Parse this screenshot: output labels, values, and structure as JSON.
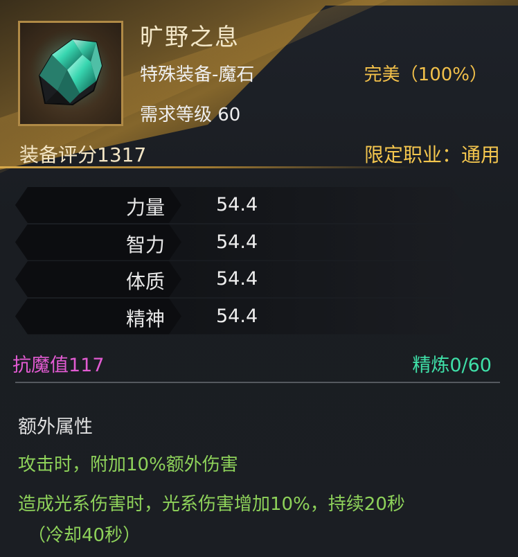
{
  "item": {
    "name": "旷野之息",
    "subtype": "特殊装备-魔石",
    "level_requirement": "需求等级 60",
    "quality": "完美（100%）",
    "score": "装备评分1317",
    "class_limit": "限定职业：通用",
    "icon": "green-crystal-magic-stone-icon"
  },
  "stats": [
    {
      "name": "力量",
      "value": "54.4"
    },
    {
      "name": "智力",
      "value": "54.4"
    },
    {
      "name": "体质",
      "value": "54.4"
    },
    {
      "name": "精神",
      "value": "54.4"
    }
  ],
  "resist": "抗魔值117",
  "refine": "精炼0/60",
  "extra": {
    "title": "额外属性",
    "lines": [
      "攻击时，附加10%额外伤害",
      "造成光系伤害时，光系伤害增加10%，持续20秒",
      "（冷却40秒）"
    ]
  },
  "colors": {
    "quality": "#f2c04a",
    "class_limit": "#f4c64e",
    "resist": "#e25bd2",
    "refine": "#3fe0a8",
    "extra_effect": "#8ed25a"
  }
}
